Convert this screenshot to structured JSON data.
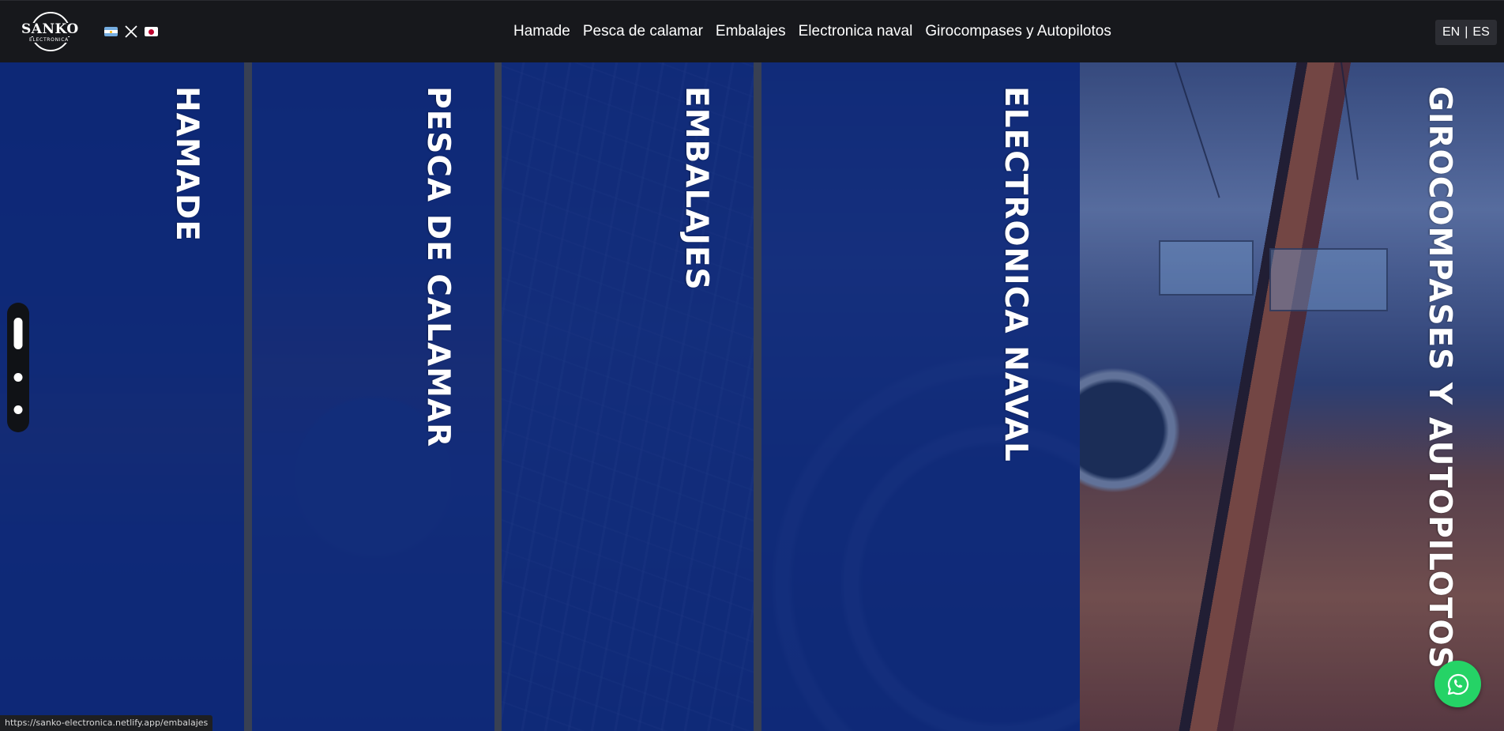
{
  "logo": {
    "name": "SANKO",
    "sub": "ELECTRONICA"
  },
  "flags": [
    "argentina-flag-icon",
    "x-close-icon",
    "japan-flag-icon"
  ],
  "nav": {
    "links": [
      "Hamade",
      "Pesca de calamar",
      "Embalajes",
      "Electronica naval",
      "Girocompases y Autopilotos"
    ]
  },
  "lang": {
    "en": "EN",
    "separator": "|",
    "es": "ES"
  },
  "panels": [
    {
      "label": "HAMADE"
    },
    {
      "label": "PESCA DE CALAMAR"
    },
    {
      "label": "EMBALAJES"
    },
    {
      "label": "ELECTRONICA NAVAL"
    },
    {
      "label": "GIROCOMPASES Y AUTOPILOTOS"
    }
  ],
  "status": {
    "url": "https://sanko-electronica.netlify.app/embalajes"
  },
  "colors": {
    "navbar": "#17181c",
    "overlay": "#0c287a",
    "whatsapp": "#25d366"
  }
}
